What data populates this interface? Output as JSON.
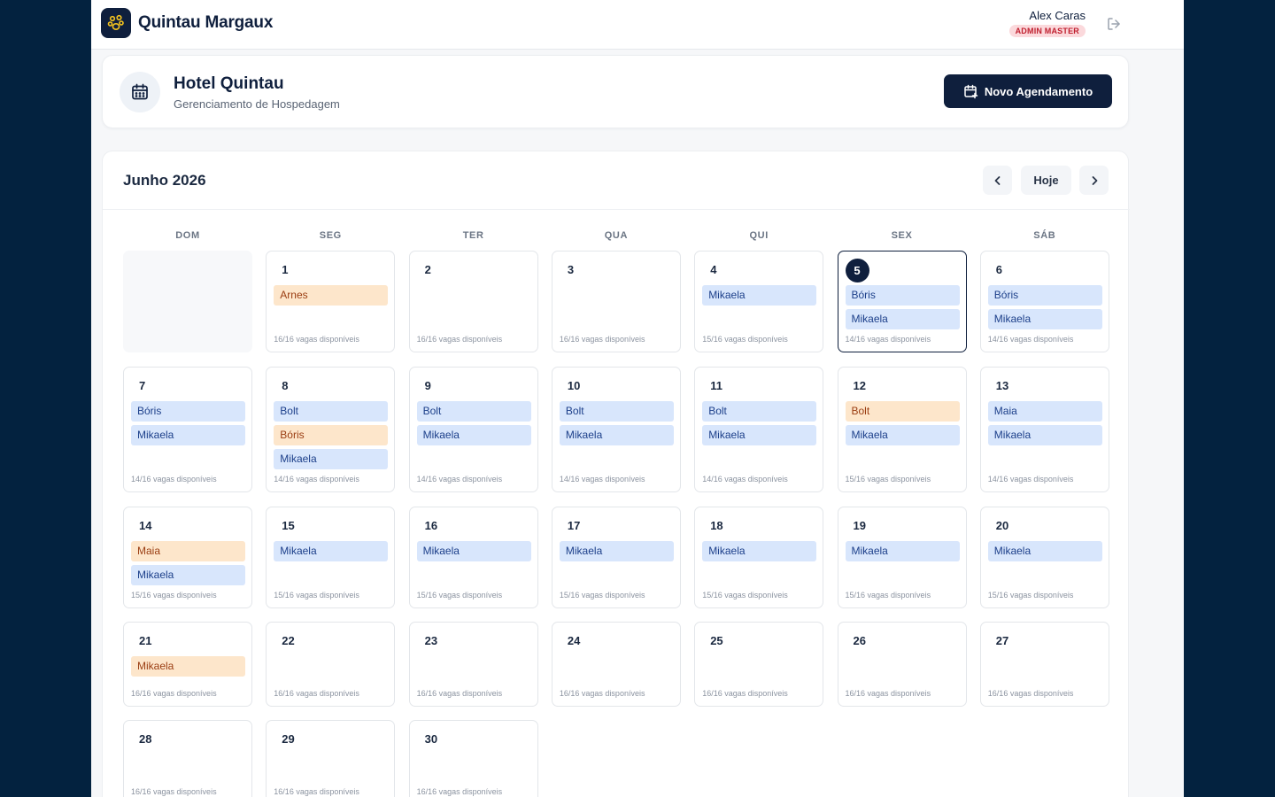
{
  "topbar": {
    "brand": "Quintau Margaux",
    "user_name": "Alex Caras",
    "user_role": "ADMIN MASTER"
  },
  "hotel": {
    "title": "Hotel Quintau",
    "subtitle": "Gerenciamento de Hospedagem",
    "new_button": "Novo Agendamento"
  },
  "calendar": {
    "month": "Junho 2026",
    "today_label": "Hoje",
    "weekdays": [
      "DOM",
      "SEG",
      "TER",
      "QUA",
      "QUI",
      "SEX",
      "SÁB"
    ],
    "today_day": 5,
    "colors": {
      "blue_bg": "#d8e6fc",
      "blue_fg": "#1c3f8a",
      "orange_bg": "#fde6cb",
      "orange_fg": "#9a3d12",
      "accent": "#0f1f3d"
    },
    "weeks": [
      [
        null,
        {
          "day": "1",
          "events": [
            {
              "name": "Arnes",
              "color": "orange"
            }
          ],
          "vagas": "16/16 vagas disponíveis"
        },
        {
          "day": "2",
          "events": [],
          "vagas": "16/16 vagas disponíveis"
        },
        {
          "day": "3",
          "events": [],
          "vagas": "16/16 vagas disponíveis"
        },
        {
          "day": "4",
          "events": [
            {
              "name": "Mikaela",
              "color": "blue"
            }
          ],
          "vagas": "15/16 vagas disponíveis"
        },
        {
          "day": "5",
          "events": [
            {
              "name": "Bóris",
              "color": "blue"
            },
            {
              "name": "Mikaela",
              "color": "blue"
            }
          ],
          "vagas": "14/16 vagas disponíveis"
        },
        {
          "day": "6",
          "events": [
            {
              "name": "Bóris",
              "color": "blue"
            },
            {
              "name": "Mikaela",
              "color": "blue"
            }
          ],
          "vagas": "14/16 vagas disponíveis"
        }
      ],
      [
        {
          "day": "7",
          "events": [
            {
              "name": "Bóris",
              "color": "blue"
            },
            {
              "name": "Mikaela",
              "color": "blue"
            }
          ],
          "vagas": "14/16 vagas disponíveis"
        },
        {
          "day": "8",
          "events": [
            {
              "name": "Bolt",
              "color": "blue"
            },
            {
              "name": "Bóris",
              "color": "orange"
            },
            {
              "name": "Mikaela",
              "color": "blue"
            }
          ],
          "vagas": "14/16 vagas disponíveis"
        },
        {
          "day": "9",
          "events": [
            {
              "name": "Bolt",
              "color": "blue"
            },
            {
              "name": "Mikaela",
              "color": "blue"
            }
          ],
          "vagas": "14/16 vagas disponíveis"
        },
        {
          "day": "10",
          "events": [
            {
              "name": "Bolt",
              "color": "blue"
            },
            {
              "name": "Mikaela",
              "color": "blue"
            }
          ],
          "vagas": "14/16 vagas disponíveis"
        },
        {
          "day": "11",
          "events": [
            {
              "name": "Bolt",
              "color": "blue"
            },
            {
              "name": "Mikaela",
              "color": "blue"
            }
          ],
          "vagas": "14/16 vagas disponíveis"
        },
        {
          "day": "12",
          "events": [
            {
              "name": "Bolt",
              "color": "orange"
            },
            {
              "name": "Mikaela",
              "color": "blue"
            }
          ],
          "vagas": "15/16 vagas disponíveis"
        },
        {
          "day": "13",
          "events": [
            {
              "name": "Maia",
              "color": "blue"
            },
            {
              "name": "Mikaela",
              "color": "blue"
            }
          ],
          "vagas": "14/16 vagas disponíveis"
        }
      ],
      [
        {
          "day": "14",
          "events": [
            {
              "name": "Maia",
              "color": "orange"
            },
            {
              "name": "Mikaela",
              "color": "blue"
            }
          ],
          "vagas": "15/16 vagas disponíveis"
        },
        {
          "day": "15",
          "events": [
            {
              "name": "Mikaela",
              "color": "blue"
            }
          ],
          "vagas": "15/16 vagas disponíveis"
        },
        {
          "day": "16",
          "events": [
            {
              "name": "Mikaela",
              "color": "blue"
            }
          ],
          "vagas": "15/16 vagas disponíveis"
        },
        {
          "day": "17",
          "events": [
            {
              "name": "Mikaela",
              "color": "blue"
            }
          ],
          "vagas": "15/16 vagas disponíveis"
        },
        {
          "day": "18",
          "events": [
            {
              "name": "Mikaela",
              "color": "blue"
            }
          ],
          "vagas": "15/16 vagas disponíveis"
        },
        {
          "day": "19",
          "events": [
            {
              "name": "Mikaela",
              "color": "blue"
            }
          ],
          "vagas": "15/16 vagas disponíveis"
        },
        {
          "day": "20",
          "events": [
            {
              "name": "Mikaela",
              "color": "blue"
            }
          ],
          "vagas": "15/16 vagas disponíveis"
        }
      ],
      [
        {
          "day": "21",
          "events": [
            {
              "name": "Mikaela",
              "color": "orange"
            }
          ],
          "vagas": "16/16 vagas disponíveis"
        },
        {
          "day": "22",
          "events": [],
          "vagas": "16/16 vagas disponíveis"
        },
        {
          "day": "23",
          "events": [],
          "vagas": "16/16 vagas disponíveis"
        },
        {
          "day": "24",
          "events": [],
          "vagas": "16/16 vagas disponíveis"
        },
        {
          "day": "25",
          "events": [],
          "vagas": "16/16 vagas disponíveis"
        },
        {
          "day": "26",
          "events": [],
          "vagas": "16/16 vagas disponíveis"
        },
        {
          "day": "27",
          "events": [],
          "vagas": "16/16 vagas disponíveis"
        }
      ],
      [
        {
          "day": "28",
          "events": [],
          "vagas": "16/16 vagas disponíveis"
        },
        {
          "day": "29",
          "events": [],
          "vagas": "16/16 vagas disponíveis"
        },
        {
          "day": "30",
          "events": [],
          "vagas": "16/16 vagas disponíveis"
        }
      ]
    ]
  },
  "icons": {
    "logo": "paw-logo-icon",
    "logout": "logout-icon",
    "hotel": "calendar-icon",
    "new": "calendar-plus-icon",
    "prev": "chevron-left-icon",
    "next": "chevron-right-icon"
  }
}
